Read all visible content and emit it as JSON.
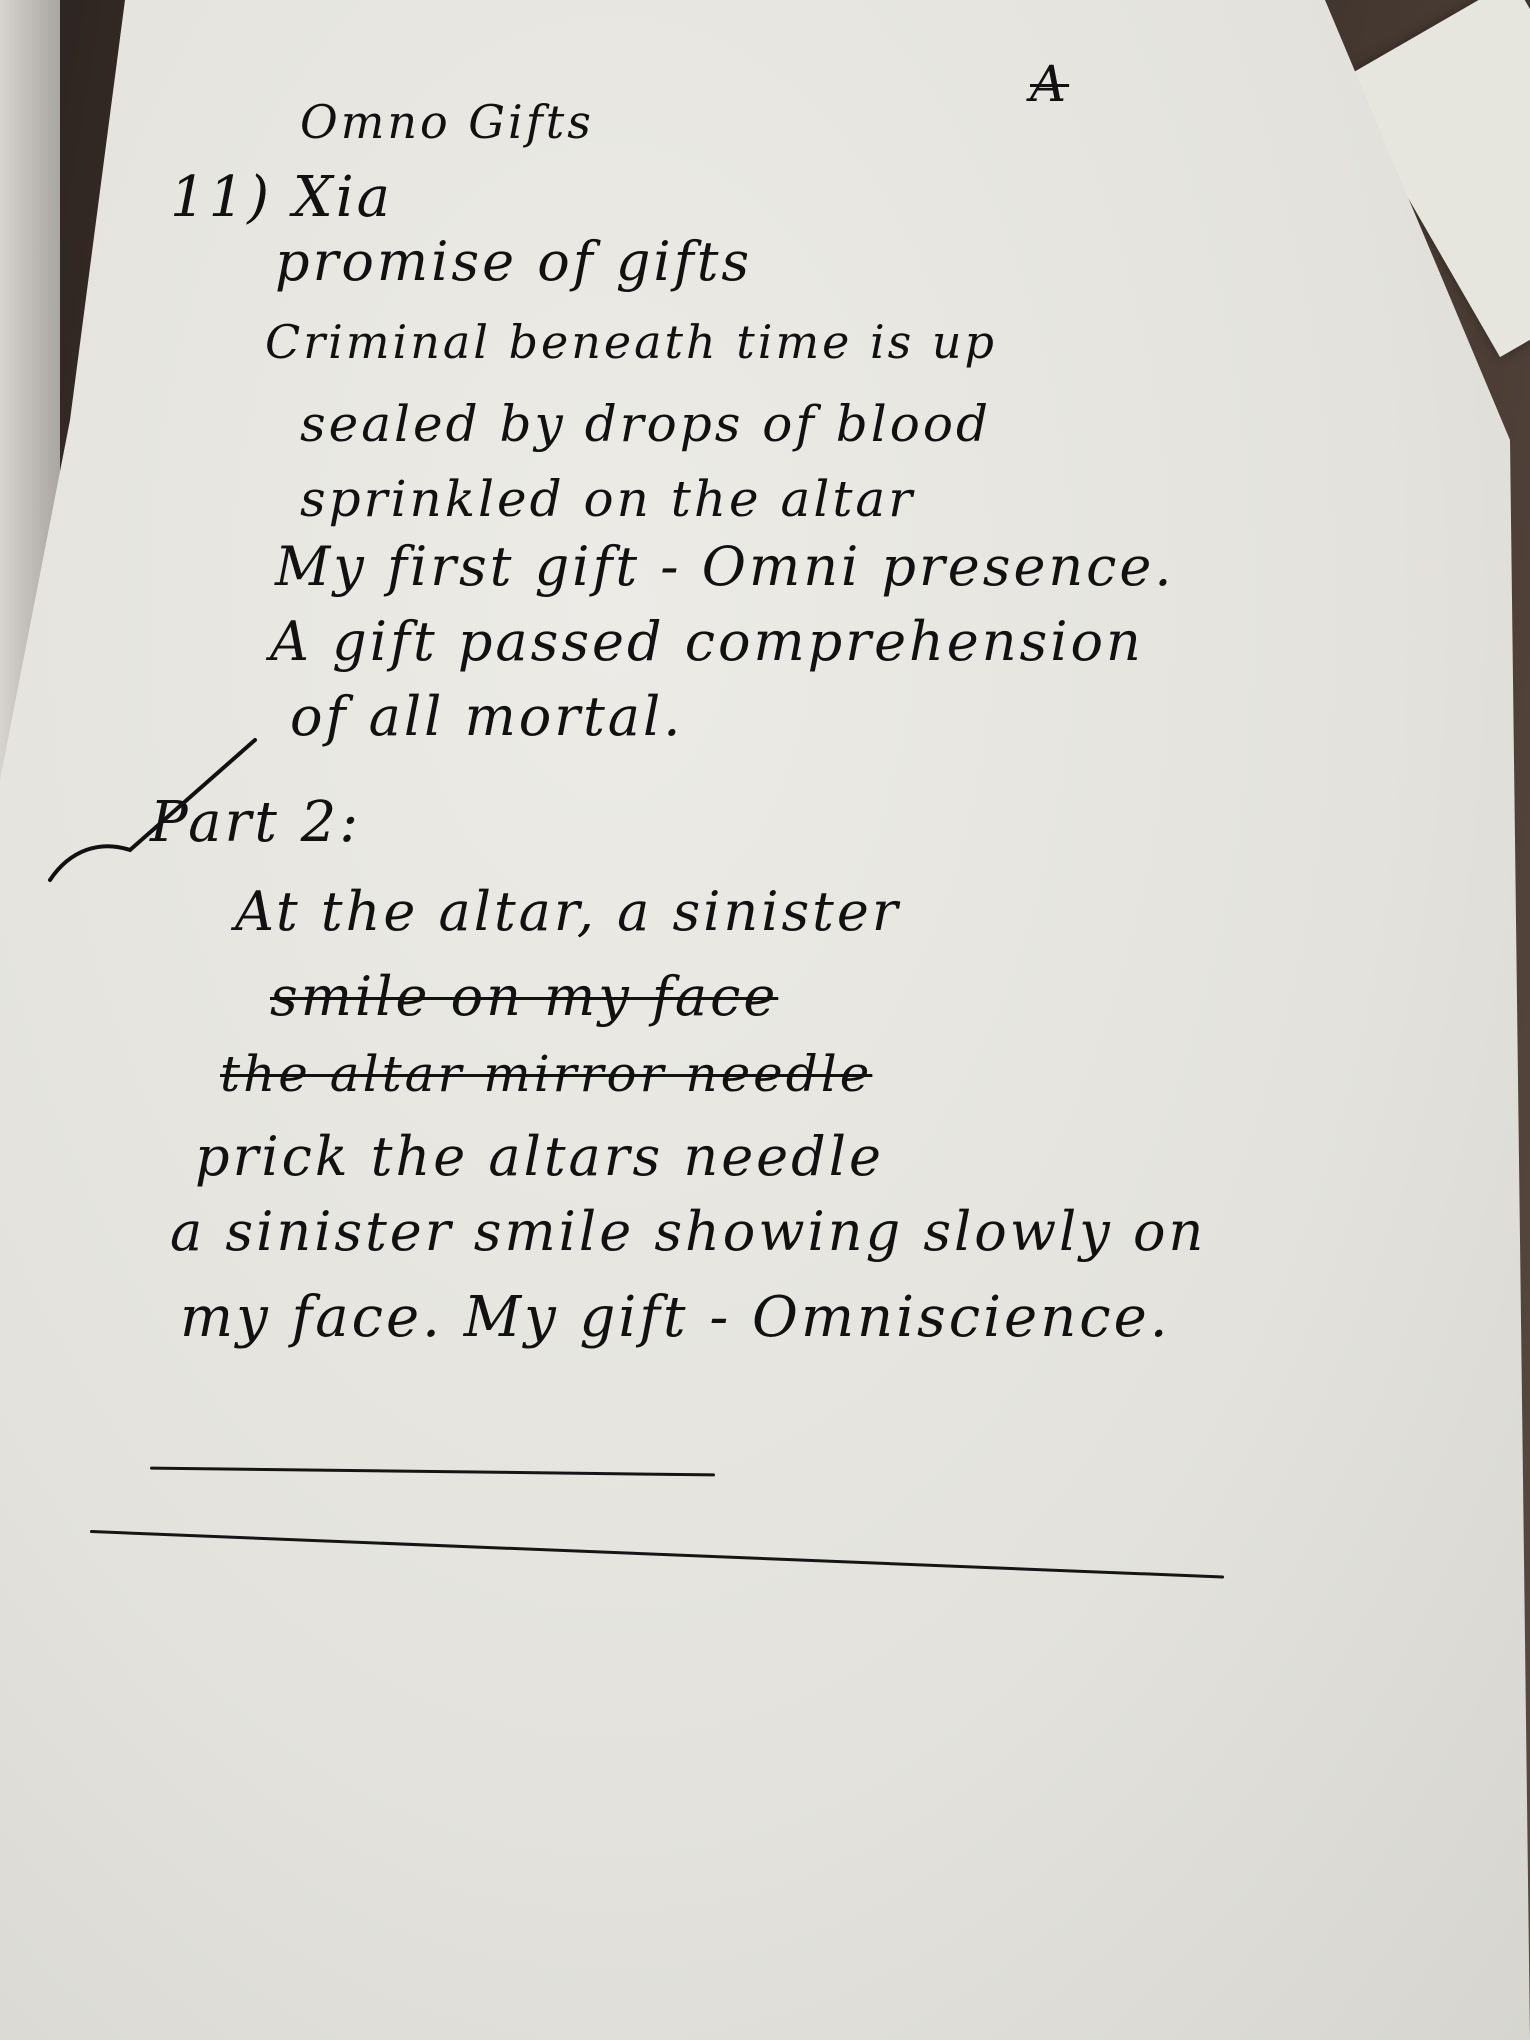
{
  "note": {
    "heading": "Omno Gifts",
    "corner_mark": "A",
    "lines": [
      "11) Xia",
      "promise of gifts",
      "Criminal beneath time is up",
      "sealed by drops of blood",
      "sprinkled on the altar",
      "My first gift - Omni presence.",
      "A gift passed comprehension",
      "of all mortal.",
      "Part 2:",
      "At the altar, a sinister",
      "smile on my face",
      "the altar mirror needle",
      "prick the altars needle",
      "a sinister smile showing slowly on",
      "my face. My gift - Omniscience."
    ]
  }
}
